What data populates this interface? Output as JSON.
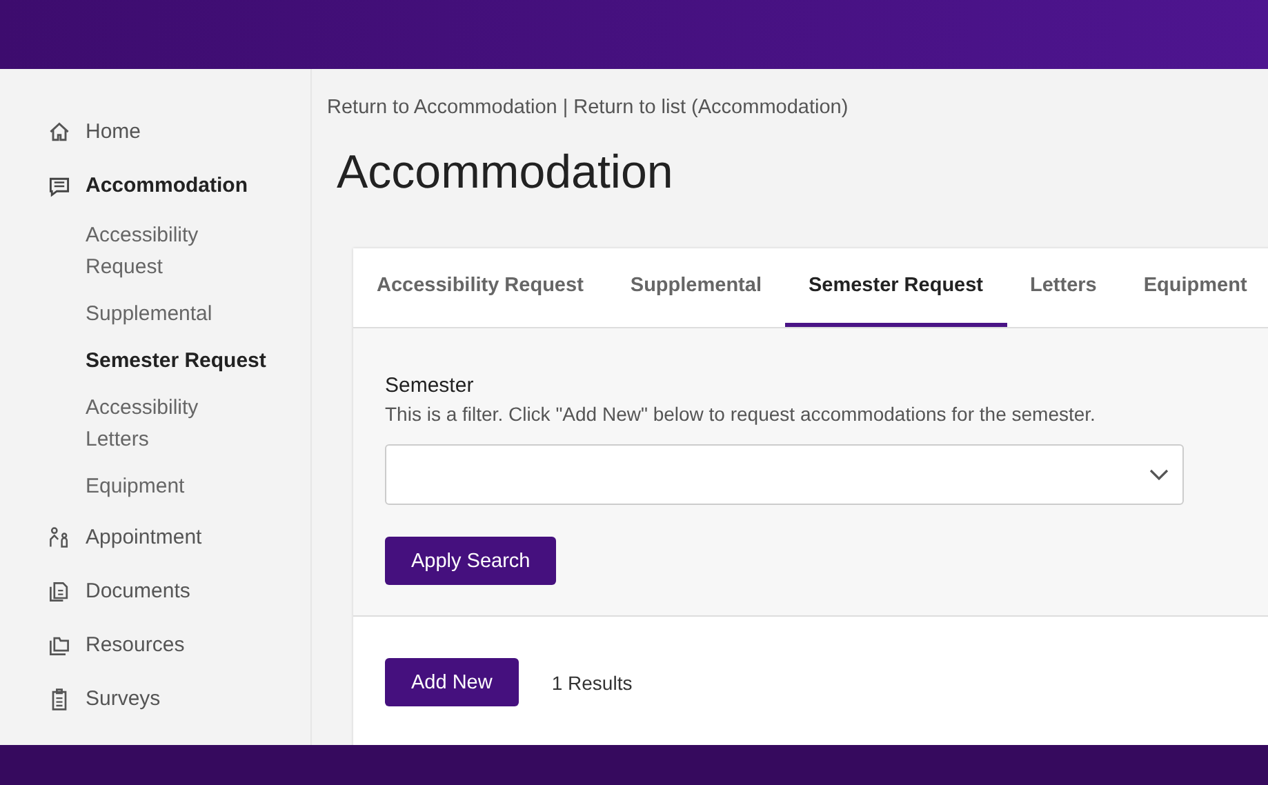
{
  "sidebar": {
    "items": [
      {
        "label": "Home",
        "kind": "home",
        "selected": false
      },
      {
        "label": "Accommodation",
        "kind": "chat",
        "selected": true,
        "children": [
          {
            "label": "Accessibility Request",
            "selected": false
          },
          {
            "label": "Supplemental",
            "selected": false
          },
          {
            "label": "Semester Request",
            "selected": true
          },
          {
            "label": "Accessibility Letters",
            "selected": false
          },
          {
            "label": "Equipment",
            "selected": false
          }
        ]
      },
      {
        "label": "Appointment",
        "kind": "people",
        "selected": false
      },
      {
        "label": "Documents",
        "kind": "documents",
        "selected": false
      },
      {
        "label": "Resources",
        "kind": "folders",
        "selected": false
      },
      {
        "label": "Surveys",
        "kind": "clipboard",
        "selected": false
      }
    ]
  },
  "breadcrumb": {
    "links": [
      "Return to Accommodation",
      "Return to list (Accommodation)"
    ],
    "separator": "|"
  },
  "page_title": "Accommodation",
  "tabs": [
    {
      "label": "Accessibility Request",
      "selected": false
    },
    {
      "label": "Supplemental",
      "selected": false
    },
    {
      "label": "Semester Request",
      "selected": true
    },
    {
      "label": "Letters",
      "selected": false
    },
    {
      "label": "Equipment",
      "selected": false
    }
  ],
  "filter": {
    "label": "Semester",
    "hint": "This is a filter. Click \"Add New\" below to request accommodations for the semester.",
    "button": "Apply Search"
  },
  "results": {
    "button": "Add New",
    "count": "1 Results"
  }
}
